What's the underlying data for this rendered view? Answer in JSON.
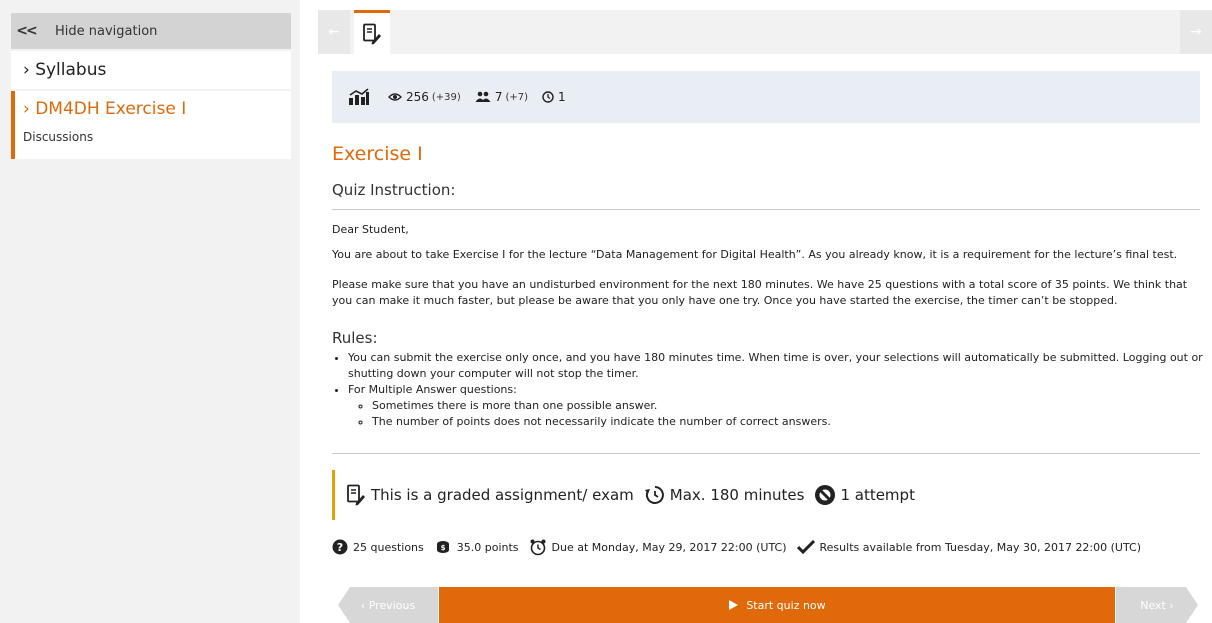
{
  "nav": {
    "hide_label": "Hide navigation",
    "items": [
      {
        "label": "› Syllabus"
      },
      {
        "label": "› DM4DH Exercise I",
        "sub": "Discussions"
      }
    ]
  },
  "topbar": {
    "prev_arrow": "←",
    "next_arrow": "→"
  },
  "stats": {
    "views": "256",
    "views_delta": "(+39)",
    "users": "7",
    "users_delta": "(+7)",
    "attempts": "1"
  },
  "page": {
    "title": "Exercise I",
    "subtitle": "Quiz Instruction:",
    "greeting": "Dear Student,",
    "para1": "You are about to take Exercise I for the lecture “Data Management for Digital Health”. As you already know, it is a requirement for the lecture’s final test.",
    "para2": "Please make sure that you have an undisturbed environment for the next 180 minutes. We have 25 questions with a total score of 35 points. We think that you can make it much faster, but please be aware that you only have one try. Once you have started the exercise, the timer can’t be stopped.",
    "rules_title": "Rules:",
    "rules": {
      "r1": "You can submit the exercise only once, and you have 180 minutes time. When time is over, your selections will automatically be submitted. Logging out or shutting down your computer will not stop the timer.",
      "r2": "For Multiple Answer questions:",
      "r2a": "Sometimes there is more than one possible answer.",
      "r2b": "The number of points does not necessarily indicate the number of correct answers."
    }
  },
  "graded": {
    "assignment": "This is a graded assignment/ exam",
    "time": "Max. 180 minutes",
    "attempts": "1 attempt"
  },
  "meta": {
    "questions": "25 questions",
    "points": "35.0 points",
    "due": "Due at Monday, May 29, 2017 22:00 (UTC)",
    "results": "Results available from Tuesday, May 30, 2017 22:00 (UTC)"
  },
  "bottom": {
    "prev": "‹ Previous",
    "start": "Start quiz now",
    "next": "Next ›"
  },
  "colors": {
    "accent": "#e06a0a",
    "graded_bar": "#e8a000",
    "stats_bg": "#e8eef4"
  }
}
